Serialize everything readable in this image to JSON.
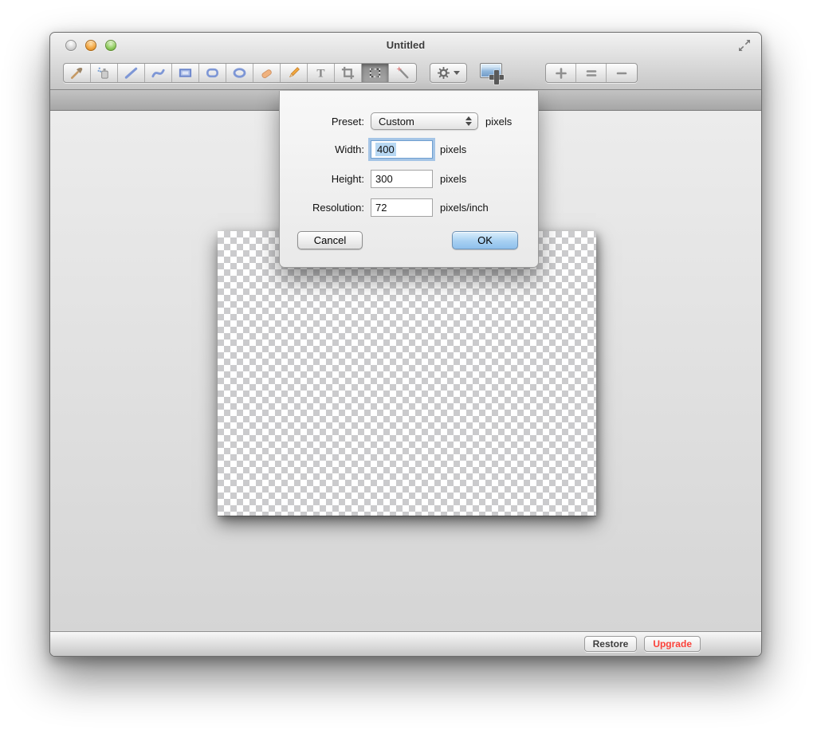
{
  "window": {
    "title": "Untitled",
    "traffic_lights": [
      "close-disabled",
      "minimize",
      "zoom"
    ],
    "fullscreen_icon": "fullscreen-arrows-icon"
  },
  "toolbar": {
    "tools": [
      {
        "name": "eyedropper",
        "icon": "eyedropper-icon",
        "selected": false
      },
      {
        "name": "spray-can",
        "icon": "spray-can-icon",
        "selected": false
      },
      {
        "name": "line",
        "icon": "line-icon",
        "selected": false
      },
      {
        "name": "curve",
        "icon": "curve-icon",
        "selected": false
      },
      {
        "name": "rectangle",
        "icon": "rectangle-icon",
        "selected": false
      },
      {
        "name": "rounded-rectangle",
        "icon": "rounded-rectangle-icon",
        "selected": false
      },
      {
        "name": "ellipse",
        "icon": "ellipse-icon",
        "selected": false
      },
      {
        "name": "eraser",
        "icon": "eraser-icon",
        "selected": false
      },
      {
        "name": "pencil",
        "icon": "pencil-icon",
        "selected": false
      },
      {
        "name": "text",
        "icon": "text-tool-icon",
        "selected": false
      },
      {
        "name": "crop",
        "icon": "crop-icon",
        "selected": false
      },
      {
        "name": "rectangular-selection",
        "icon": "selection-marquee-icon",
        "selected": true
      },
      {
        "name": "magic-wand",
        "icon": "magic-wand-icon",
        "selected": false
      }
    ],
    "text_tool_glyph": "T",
    "gear_button_icon": "gear-icon",
    "add_image_button_icon": "add-image-icon",
    "zoom_controls": [
      "zoom-in",
      "actual-size",
      "zoom-out"
    ]
  },
  "sheet": {
    "preset": {
      "label": "Preset:",
      "value": "Custom",
      "suffix": "pixels"
    },
    "width": {
      "label": "Width:",
      "value": "400",
      "suffix": "pixels",
      "focused": true
    },
    "height": {
      "label": "Height:",
      "value": "300",
      "suffix": "pixels"
    },
    "resolution": {
      "label": "Resolution:",
      "value": "72",
      "suffix": "pixels/inch"
    },
    "cancel_label": "Cancel",
    "ok_label": "OK"
  },
  "footer": {
    "restore_label": "Restore",
    "upgrade_label": "Upgrade"
  },
  "colors": {
    "ok_button_blue": "#9ec9f0",
    "focus_ring_blue": "#70a5dc",
    "selection_highlight_blue": "#b8d8f3",
    "upgrade_text_red": "#fb423a",
    "checker_gray": "#cbcbcd",
    "tool_blue": "#7e97d6"
  }
}
